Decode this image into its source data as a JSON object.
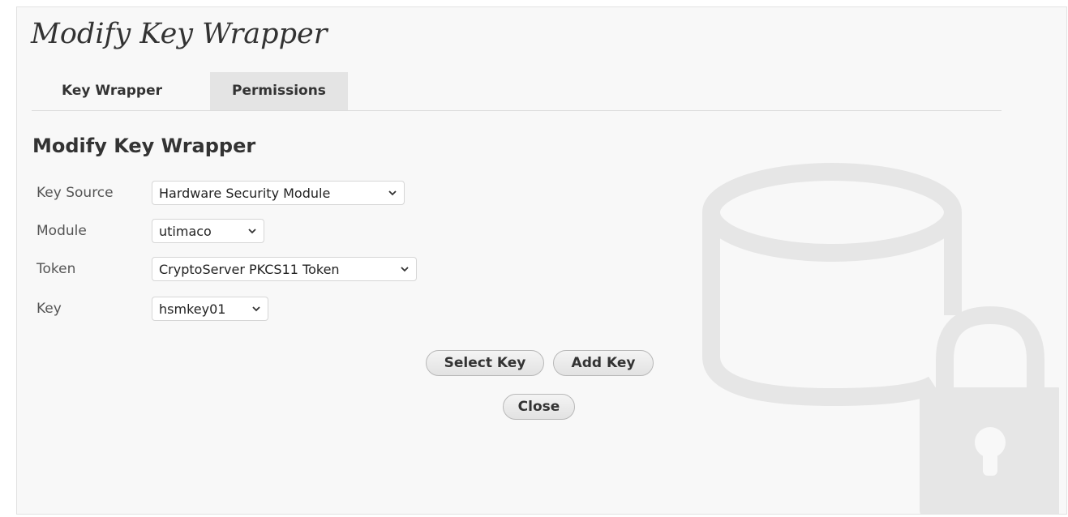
{
  "page": {
    "title": "Modify Key Wrapper"
  },
  "tabs": [
    {
      "label": "Key Wrapper",
      "active": true
    },
    {
      "label": "Permissions",
      "active": false
    }
  ],
  "form": {
    "section_title": "Modify Key Wrapper",
    "fields": [
      {
        "label": "Key Source",
        "value": "Hardware Security Module"
      },
      {
        "label": "Module",
        "value": "utimaco"
      },
      {
        "label": "Token",
        "value": "CryptoServer PKCS11 Token"
      },
      {
        "label": "Key",
        "value": "hsmkey01"
      }
    ]
  },
  "buttons": {
    "select_key": "Select Key",
    "add_key": "Add Key",
    "close": "Close"
  },
  "background_icon": "database-lock-icon",
  "colors": {
    "panel_background": "#f8f8f8",
    "inactive_tab": "#e4e4e4",
    "watermark": "#e6e6e6"
  }
}
